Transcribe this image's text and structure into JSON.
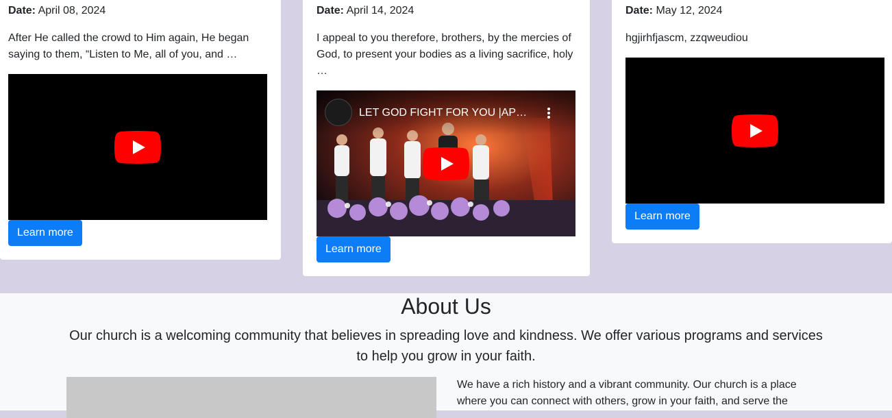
{
  "sermons": [
    {
      "date_label": "Date:",
      "date": "April 08, 2024",
      "excerpt": "After He called the crowd to Him again, He began saying to them, “Listen to Me, all of you, and …",
      "video": {
        "title": ""
      },
      "button_label": "Learn more"
    },
    {
      "date_label": "Date:",
      "date": "April 14, 2024",
      "excerpt": "I appeal to you therefore, brothers, by the mercies of God, to present your bodies as a living sacrifice, holy …",
      "video": {
        "title": "LET GOD FIGHT FOR YOU |AP…"
      },
      "button_label": "Learn more"
    },
    {
      "date_label": "Date:",
      "date": "May 12, 2024",
      "excerpt": "hgjirhfjascm, zzqweudiou",
      "video": {
        "title": ""
      },
      "button_label": "Learn more"
    }
  ],
  "about": {
    "heading": "About Us",
    "lead": "Our church is a welcoming community that believes in spreading love and kindness. We offer various programs and services to help you grow in your faith.",
    "history": "We have a rich history and a vibrant community. Our church is a place where you can connect with others, grow in your faith, and serve the"
  },
  "icons": {
    "play": "youtube-play-icon",
    "more": "more-vertical-icon",
    "channel": "channel-logo-icon"
  },
  "colors": {
    "page_background": "#d6d1e5",
    "button": "#0d7cf7",
    "youtube_red": "#ff0000",
    "about_background": "#f8f9fa"
  }
}
